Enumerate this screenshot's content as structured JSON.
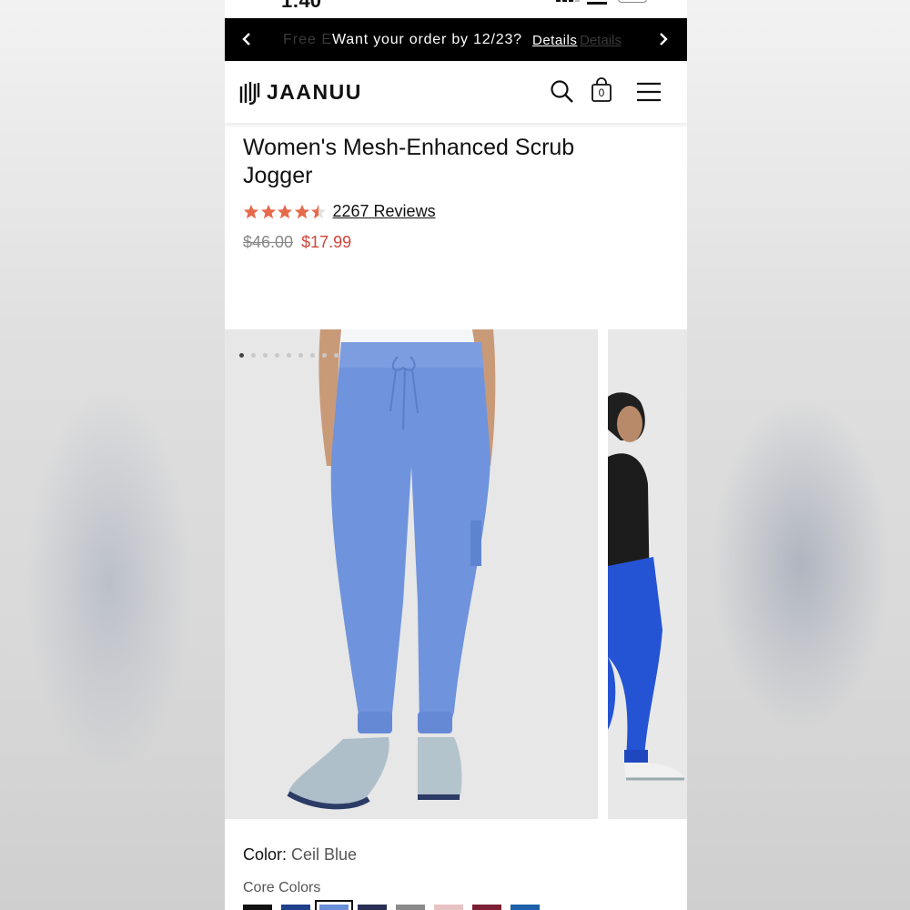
{
  "status_bar": {
    "time": "1:40"
  },
  "promo": {
    "ghost_text": "Free E",
    "ghost_link": "Details",
    "message": "Want your order by 12/23?",
    "link": "Details"
  },
  "header": {
    "brand": "JAANUU",
    "cart_count": "0"
  },
  "product": {
    "title": "Women's Mesh-Enhanced Scrub Jogger",
    "rating": 4.5,
    "reviews": "2267 Reviews",
    "price_original": "$46.00",
    "price_sale": "$17.99"
  },
  "gallery": {
    "slide_count": 9,
    "active_slide": 1
  },
  "color": {
    "label": "Color:",
    "value": "Ceil Blue",
    "group_label": "Core Colors",
    "swatches": [
      {
        "name": "black",
        "color": "#111111"
      },
      {
        "name": "navy",
        "color": "#1f3f8a"
      },
      {
        "name": "ceil blue",
        "color": "#6b8fd6",
        "selected": true
      },
      {
        "name": "dark navy",
        "color": "#2a2f55"
      },
      {
        "name": "gray",
        "color": "#8a8a8a"
      },
      {
        "name": "blush",
        "color": "#e7c3c3"
      },
      {
        "name": "burgundy",
        "color": "#7c2036"
      },
      {
        "name": "royal",
        "color": "#1d5fa8"
      }
    ]
  },
  "colors": {
    "accent_star": "#e56a4a",
    "sale_price": "#d0453a",
    "promo_bg": "#000000"
  }
}
